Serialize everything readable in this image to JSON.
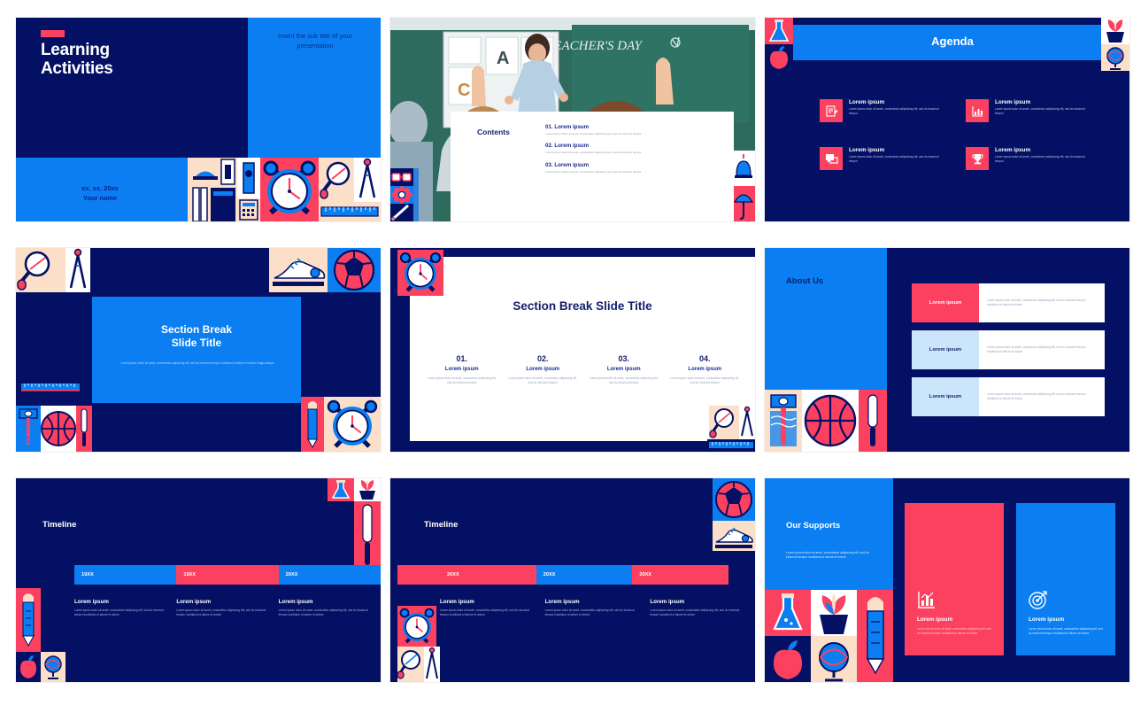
{
  "theme": {
    "navy": "#041063",
    "blue": "#0b7ff2",
    "pink": "#fc4160",
    "cream": "#fbdfc8",
    "light_blue": "#cbe6fb",
    "white": "#ffffff"
  },
  "lorem": {
    "short": "Lorem ipsum",
    "body_short": "Lorem ipsum dolor sit amet, consectetur adipiscing elit, sed do eiusmod tempor",
    "body_medium": "Lorem ipsum dolor sit amet, consectetur adipiscing elit, sed do eiusmod tempor incididunt ut labore et dolore",
    "body_long": "Lorem ipsum dolor sit amet, consectetur adipiscing elit, sed do eiusmod tempor incididunt ut labore et dolore magna aliqua"
  },
  "slide1": {
    "title": "Learning\nActivities",
    "subtitle": "Insert the sub title of your presentation",
    "date": "xx. xx. 20xx",
    "author": "Your name"
  },
  "slide2": {
    "heading": "Contents",
    "items": [
      {
        "label": "01. Lorem ipsum",
        "body": "Lorem ipsum dolor sit amet, consectetur adipiscing elit, sed do eiusmod tempor"
      },
      {
        "label": "02. Lorem ipsum",
        "body": "Lorem ipsum dolor sit amet, consectetur adipiscing elit, sed do eiusmod tempor"
      },
      {
        "label": "03. Lorem ipsum",
        "body": "Lorem ipsum dolor sit amet, consectetur adipiscing elit, sed do eiusmod tempor"
      }
    ],
    "photo_text": "TEACHER'S DAY"
  },
  "slide3": {
    "title": "Agenda",
    "items": [
      {
        "icon": "document-edit-icon",
        "label": "Lorem ipsum",
        "body": "Lorem ipsum dolor sit amet, consectetur adipisicing elit, sed do eiusmod tempor"
      },
      {
        "icon": "bar-chart-icon",
        "label": "Lorem ipsum",
        "body": "Lorem ipsum dolor sit amet, consectetur adipisicing elit, sed do eiusmod tempor"
      },
      {
        "icon": "chat-bubbles-icon",
        "label": "Lorem ipsum",
        "body": "Lorem ipsum dolor sit amet, consectetur adipisicing elit, sed do eiusmod tempor"
      },
      {
        "icon": "trophy-icon",
        "label": "Lorem ipsum",
        "body": "Lorem ipsum dolor sit amet, consectetur adipisicing elit, sed do eiusmod tempor"
      }
    ]
  },
  "slide4": {
    "title": "Section Break\nSlide Title",
    "body": "Lorem ipsum dolor sit amet, consectetur adipiscing elit, sed do eiusmod tempor incididunt ut labore et dolore magna aliqua"
  },
  "slide5": {
    "title": "Section Break Slide Title",
    "columns": [
      {
        "number": "01.",
        "label": "Lorem ipsum",
        "body": "Lorem ipsum dolor sit amet, consectetur adipiscing elit, sed do eiusmod tempor"
      },
      {
        "number": "02.",
        "label": "Lorem ipsum",
        "body": "Lorem ipsum dolor sit amet, consectetur adipiscing elit, sed do eiusmod tempor"
      },
      {
        "number": "03.",
        "label": "Lorem ipsum",
        "body": "Lorem ipsum dolor sit amet, consectetur adipiscing elit, sed do eiusmod tempor"
      },
      {
        "number": "04.",
        "label": "Lorem ipsum",
        "body": "Lorem ipsum dolor sit amet, consectetur adipiscing elit, sed do eiusmod tempor"
      }
    ]
  },
  "slide6": {
    "title": "About Us",
    "rows": [
      {
        "tag": "Lorem ipsum",
        "tag_color": "#fc4160",
        "tag_text_color": "#ffffff",
        "body": "Lorem ipsum dolor sit amet, consectetur adipiscing elit, sed do eiusmod tempor incididunt ut labore et dolore"
      },
      {
        "tag": "Lorem ipsum",
        "tag_color": "#cbe6fb",
        "tag_text_color": "#131f6b",
        "body": "Lorem ipsum dolor sit amet, consectetur adipiscing elit, sed do eiusmod tempor incididunt ut labore et dolore"
      },
      {
        "tag": "Lorem ipsum",
        "tag_color": "#cbe6fb",
        "tag_text_color": "#131f6b",
        "body": "Lorem ipsum dolor sit amet, consectetur adipiscing elit, sed do eiusmod tempor incididunt ut labore et dolore"
      }
    ]
  },
  "slide7": {
    "title": "Timeline",
    "years": [
      {
        "label": "19XX",
        "color": "#0b7ff2"
      },
      {
        "label": "19XX",
        "color": "#fc4160"
      },
      {
        "label": "20XX",
        "color": "#0b7ff2"
      }
    ],
    "columns": [
      {
        "label": "Lorem ipsum",
        "body": "Lorem ipsum dolor sit amet, consectetur adipiscing elit, sed do eiusmod tempor incididunt ut labore et dolore"
      },
      {
        "label": "Lorem ipsum",
        "body": "Lorem ipsum dolor sit amet, consectetur adipiscing elit, sed do eiusmod tempor incididunt ut labore et dolore"
      },
      {
        "label": "Lorem ipsum",
        "body": "Lorem ipsum dolor sit amet, consectetur adipiscing elit, sed do eiusmod tempor incididunt ut labore et dolore"
      }
    ]
  },
  "slide8": {
    "title": "Timeline",
    "years": [
      {
        "label": "20XX",
        "color": "#fc4160"
      },
      {
        "label": "20XX",
        "color": "#0b7ff2"
      },
      {
        "label": "20XX",
        "color": "#fc4160"
      }
    ],
    "columns": [
      {
        "label": "Lorem ipsum",
        "body": "Lorem ipsum dolor sit amet, consectetur adipiscing elit, sed do eiusmod tempor incididunt ut labore et dolore"
      },
      {
        "label": "Lorem ipsum",
        "body": "Lorem ipsum dolor sit amet, consectetur adipiscing elit, sed do eiusmod tempor incididunt ut labore et dolore"
      },
      {
        "label": "Lorem ipsum",
        "body": "Lorem ipsum dolor sit amet, consectetur adipiscing elit, sed do eiusmod tempor incididunt ut labore et dolore"
      }
    ]
  },
  "slide9": {
    "title": "Our Supports",
    "body": "Lorem ipsum dolor sit amet, consectetur adipiscing elit, sed do eiusmod tempor incididunt ut labore et dolore",
    "cards": [
      {
        "icon": "bar-chart-icon",
        "color": "#fc4160",
        "label": "Lorem ipsum",
        "body": "Lorem ipsum dolor sit amet, consectetur adipiscing elit, sed do eiusmod tempor incididunt ut labore et dolore"
      },
      {
        "icon": "target-icon",
        "color": "#0b7ff2",
        "label": "Lorem ipsum",
        "body": "Lorem ipsum dolor sit amet, consectetur adipiscing elit, sed do eiusmod tempor incididunt ut labore et dolore"
      }
    ]
  }
}
